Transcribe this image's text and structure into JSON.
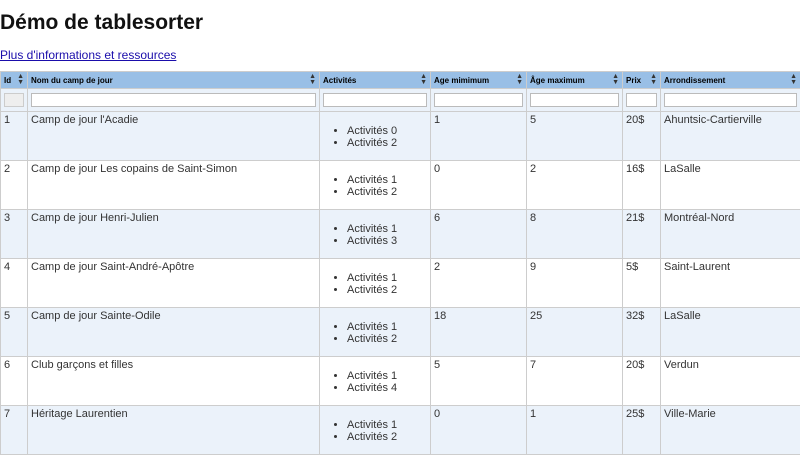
{
  "page": {
    "title": "Démo de tablesorter",
    "link": "Plus d'informations et ressources"
  },
  "columns": [
    {
      "key": "id",
      "label": "Id"
    },
    {
      "key": "name",
      "label": "Nom du camp de jour"
    },
    {
      "key": "activities",
      "label": "Activités"
    },
    {
      "key": "min_age",
      "label": "Age mimimum"
    },
    {
      "key": "max_age",
      "label": "Âge maximum"
    },
    {
      "key": "price",
      "label": "Prix"
    },
    {
      "key": "borough",
      "label": "Arrondissement"
    }
  ],
  "rows": [
    {
      "id": "1",
      "name": "Camp de jour l'Acadie",
      "activities": [
        "Activités 0",
        "Activités 2"
      ],
      "min_age": "1",
      "max_age": "5",
      "price": "20$",
      "borough": "Ahuntsic-Cartierville"
    },
    {
      "id": "2",
      "name": "Camp de jour Les copains de Saint-Simon",
      "activities": [
        "Activités 1",
        "Activités 2"
      ],
      "min_age": "0",
      "max_age": "2",
      "price": "16$",
      "borough": "LaSalle"
    },
    {
      "id": "3",
      "name": "Camp de jour Henri-Julien",
      "activities": [
        "Activités 1",
        "Activités 3"
      ],
      "min_age": "6",
      "max_age": "8",
      "price": "21$",
      "borough": "Montréal-Nord"
    },
    {
      "id": "4",
      "name": "Camp de jour Saint-André-Apôtre",
      "activities": [
        "Activités 1",
        "Activités 2"
      ],
      "min_age": "2",
      "max_age": "9",
      "price": "5$",
      "borough": "Saint-Laurent"
    },
    {
      "id": "5",
      "name": "Camp de jour Sainte-Odile",
      "activities": [
        "Activités 1",
        "Activités 2"
      ],
      "min_age": "18",
      "max_age": "25",
      "price": "32$",
      "borough": "LaSalle"
    },
    {
      "id": "6",
      "name": "Club garçons et filles",
      "activities": [
        "Activités 1",
        "Activités 4"
      ],
      "min_age": "5",
      "max_age": "7",
      "price": "20$",
      "borough": "Verdun"
    },
    {
      "id": "7",
      "name": "Héritage Laurentien",
      "activities": [
        "Activités 1",
        "Activités 2"
      ],
      "min_age": "0",
      "max_age": "1",
      "price": "25$",
      "borough": "Ville-Marie"
    }
  ],
  "colors": {
    "header_bg": "#99bfe6",
    "odd_row_bg": "#ebf2fa",
    "even_row_bg": "#ffffff",
    "border": "#cdcdcd"
  },
  "icons": {
    "sort": "sort-updown-icon"
  }
}
